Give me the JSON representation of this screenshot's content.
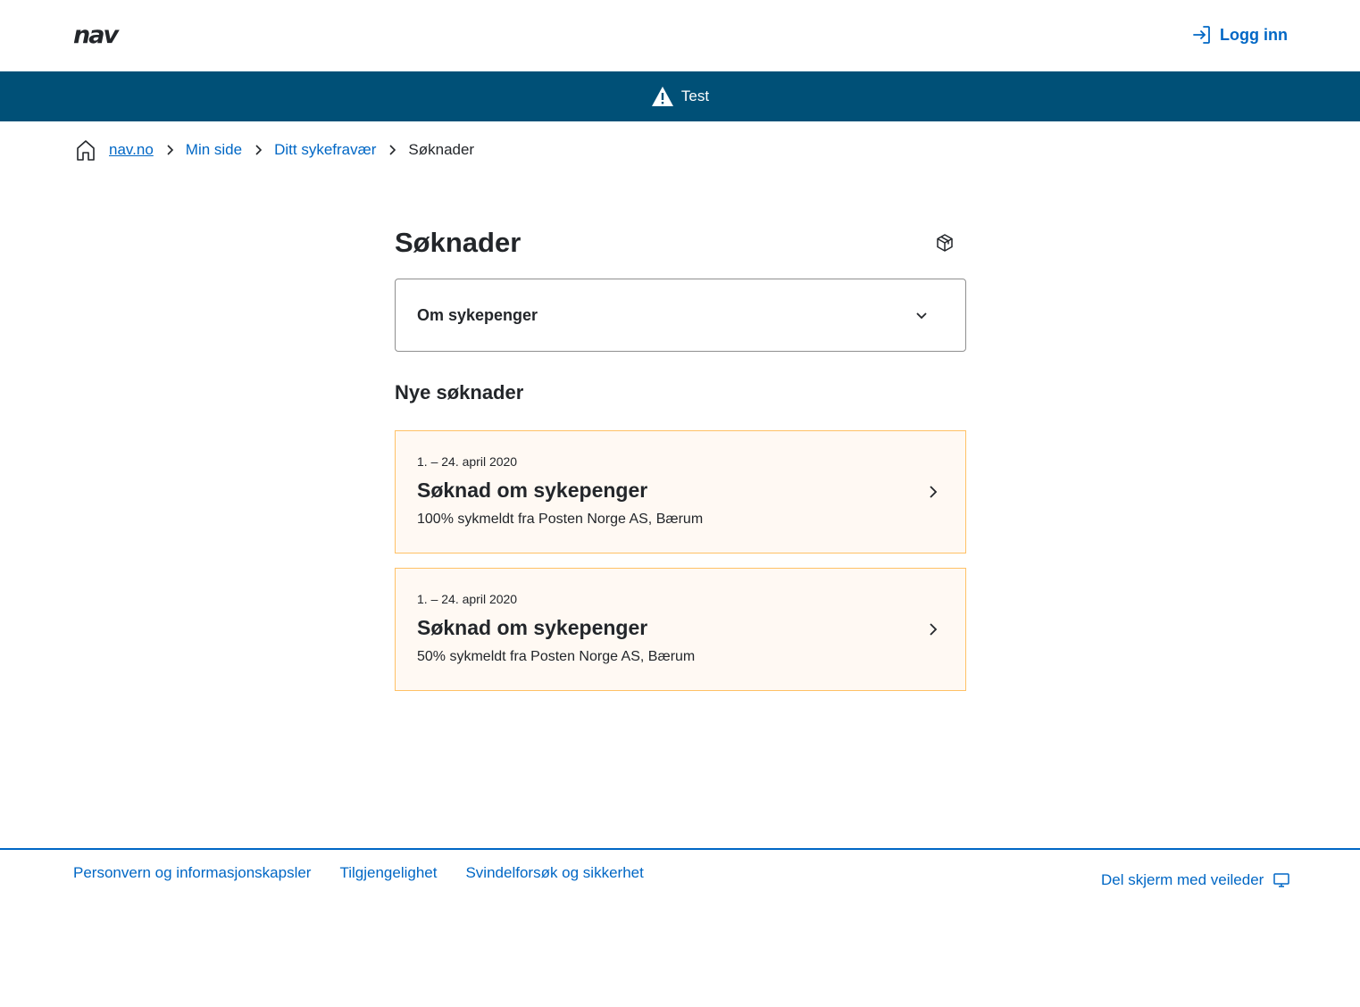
{
  "header": {
    "logo_text": "nav",
    "login_label": "Logg inn"
  },
  "banner": {
    "text": "Test",
    "background": "#005077"
  },
  "breadcrumb": {
    "items": [
      {
        "label": "nav.no"
      },
      {
        "label": "Min side"
      },
      {
        "label": "Ditt sykefravær"
      },
      {
        "label": "Søknader"
      }
    ]
  },
  "main": {
    "title": "Søknader",
    "accordion_label": "Om sykepenger",
    "section_heading": "Nye søknader",
    "cards": [
      {
        "date": "1. – 24. april 2020",
        "title": "Søknad om sykepenger",
        "description": "100% sykmeldt fra Posten Norge AS, Bærum"
      },
      {
        "date": "1. – 24. april 2020",
        "title": "Søknad om sykepenger",
        "description": "50% sykmeldt fra Posten Norge AS, Bærum"
      }
    ]
  },
  "footer": {
    "links": [
      {
        "label": "Personvern og informasjonskapsler"
      },
      {
        "label": "Tilgjengelighet"
      },
      {
        "label": "Svindelforsøk og sikkerhet"
      }
    ],
    "share_label": "Del skjerm med veileder"
  },
  "colors": {
    "link": "#0067c5",
    "card_background": "#fff9f3",
    "card_border": "#ffc166"
  }
}
